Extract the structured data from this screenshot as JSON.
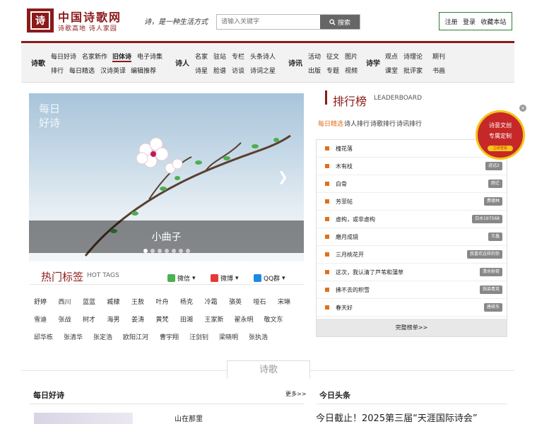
{
  "header": {
    "logo_glyph": "诗",
    "site_name": "中国诗歌网",
    "site_sub": "诗歌高地 诗人家园",
    "slogan": "诗，是一种生活方式",
    "search_placeholder": "请输入关键字",
    "search_label": "搜索",
    "account": {
      "register": "注册",
      "login": "登录",
      "favorite": "收藏本站"
    }
  },
  "nav": [
    {
      "head": "诗歌",
      "rows": [
        [
          "每日好诗",
          "名家新作",
          "旧体诗",
          "电子诗集"
        ],
        [
          "排行",
          "每日精选",
          "汉诗英译",
          "编辑推荐"
        ]
      ],
      "active": "旧体诗"
    },
    {
      "head": "诗人",
      "rows": [
        [
          "名家",
          "驻站",
          "专栏",
          "头条诗人"
        ],
        [
          "诗星",
          "脸谱",
          "访谈",
          "诗词之星"
        ]
      ]
    },
    {
      "head": "诗讯",
      "rows": [
        [
          "活动",
          "征文",
          "图片"
        ],
        [
          "出版",
          "专题",
          "视频"
        ]
      ]
    },
    {
      "head": "诗学",
      "rows": [
        [
          "观点",
          "诗理论",
          "期刊"
        ],
        [
          "课堂",
          "批评家",
          "书画"
        ]
      ]
    }
  ],
  "slider": {
    "badge": [
      "每日",
      "好诗"
    ],
    "caption": "小曲子",
    "next_glyph": "❯",
    "dot_count": 7,
    "active_dot": 0
  },
  "hot_tags": {
    "title": "热门标签",
    "title_en": "HOT TAGS",
    "share": [
      "微信",
      "微博",
      "QQ群"
    ],
    "rows": [
      [
        "舒婷",
        "西川",
        "蓝蓝",
        "臧棣",
        "王敖",
        "叶舟",
        "杨克",
        "冷霜",
        "骆英",
        "哑石",
        "宋琳"
      ],
      [
        "雪迪",
        "张战",
        "树才",
        "海男",
        "姜涛",
        "黄梵",
        "田湘",
        "王家新",
        "翟永明",
        "敬文东"
      ],
      [
        "邱华栋",
        "张清华",
        "张定浩",
        "欧阳江河",
        "曹宇翔",
        "汪剑钊",
        "梁晓明",
        "张执浩"
      ]
    ]
  },
  "leaderboard": {
    "title": "排行榜",
    "title_en": "LEADERBOARD",
    "tabs": [
      "每日精选",
      "诗人排行",
      "诗歌排行",
      "诗讯排行"
    ],
    "active_tab": 0,
    "items": [
      {
        "title": "槐花落",
        "author": ""
      },
      {
        "title": "木有枝",
        "author": "迹远2"
      },
      {
        "title": "白骨",
        "author": "颜迁"
      },
      {
        "title": "芳菲帖",
        "author": "费德林"
      },
      {
        "title": "虚构，或非虚构",
        "author": "白水197568"
      },
      {
        "title": "磨月成镜",
        "author": "王鑫"
      },
      {
        "title": "三月桃花开",
        "author": "我喜欢这样的你"
      },
      {
        "title": "这次，我认清了芦苇和蒲草",
        "author": "清水秋荷"
      },
      {
        "title": "拂不去的积雪",
        "author": "指染青岚"
      },
      {
        "title": "春天好",
        "author": "唐续东"
      }
    ],
    "more": "完整榜单>>"
  },
  "promo": {
    "line1": "诗意文创",
    "line2": "专属定制",
    "line3": "立即查看",
    "close": "×"
  },
  "section": {
    "tab": "诗歌",
    "daily_title": "每日好诗",
    "daily_more": "更多>>",
    "daily_poem": "山在那里",
    "news_title": "今日头条",
    "news_headline": "今日截止！2025第三届“天涯国际诗会”"
  },
  "colors": {
    "brand": "#8b1a1a",
    "accent": "#e0701a",
    "search_btn": "#666666",
    "account_border": "#2e7d32"
  }
}
